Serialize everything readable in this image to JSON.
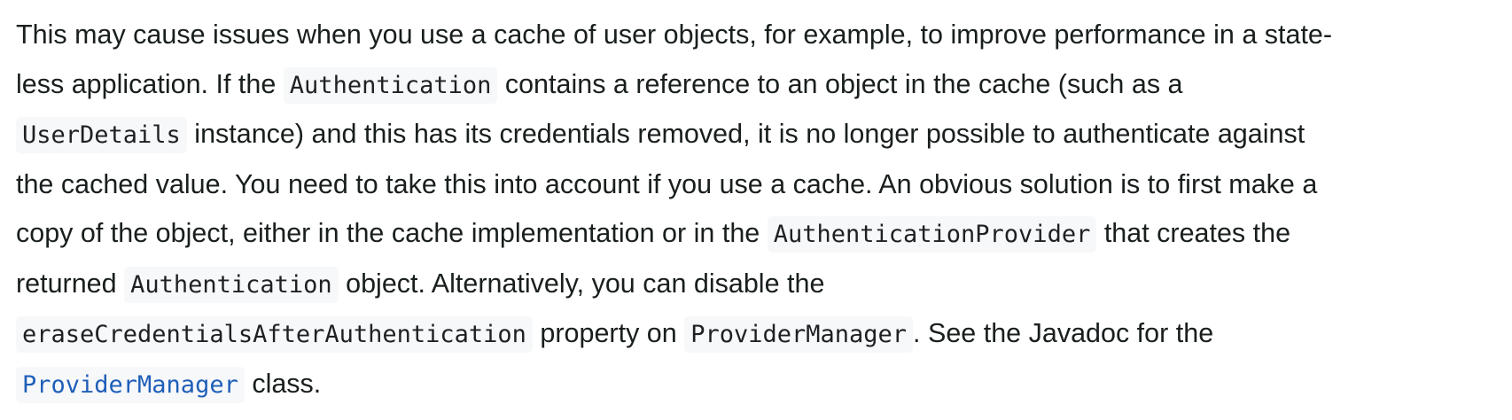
{
  "paragraph": {
    "lines": [
      {
        "t1": "This may cause issues when you use a cache of user objects, for example, to improve performance in a state-"
      },
      {
        "t1": "less application. If the ",
        "c1": "Authentication",
        "t2": " contains a reference to an object in the cache (such as a"
      },
      {
        "c1": "UserDetails",
        "t1": " instance) and this has its credentials removed, it is no longer possible to authenticate against"
      },
      {
        "t1": "the cached value. You need to take this into account if you use a cache. An obvious solution is to first make a"
      },
      {
        "t1": "copy of the object, either in the cache implementation or in the ",
        "c1": "AuthenticationProvider",
        "t2": " that creates the"
      },
      {
        "t1": "returned ",
        "c1": "Authentication",
        "t2": " object. Alternatively, you can disable the"
      },
      {
        "c1": "eraseCredentialsAfterAuthentication",
        "t1": " property on ",
        "c2": "ProviderManager",
        "t2": ". See the Javadoc for the"
      },
      {
        "link": "ProviderManager",
        "t1": " class."
      }
    ]
  },
  "colors": {
    "text": "#191e1e",
    "code_bg": "#f7f8fa",
    "link": "#1f5fb8"
  }
}
